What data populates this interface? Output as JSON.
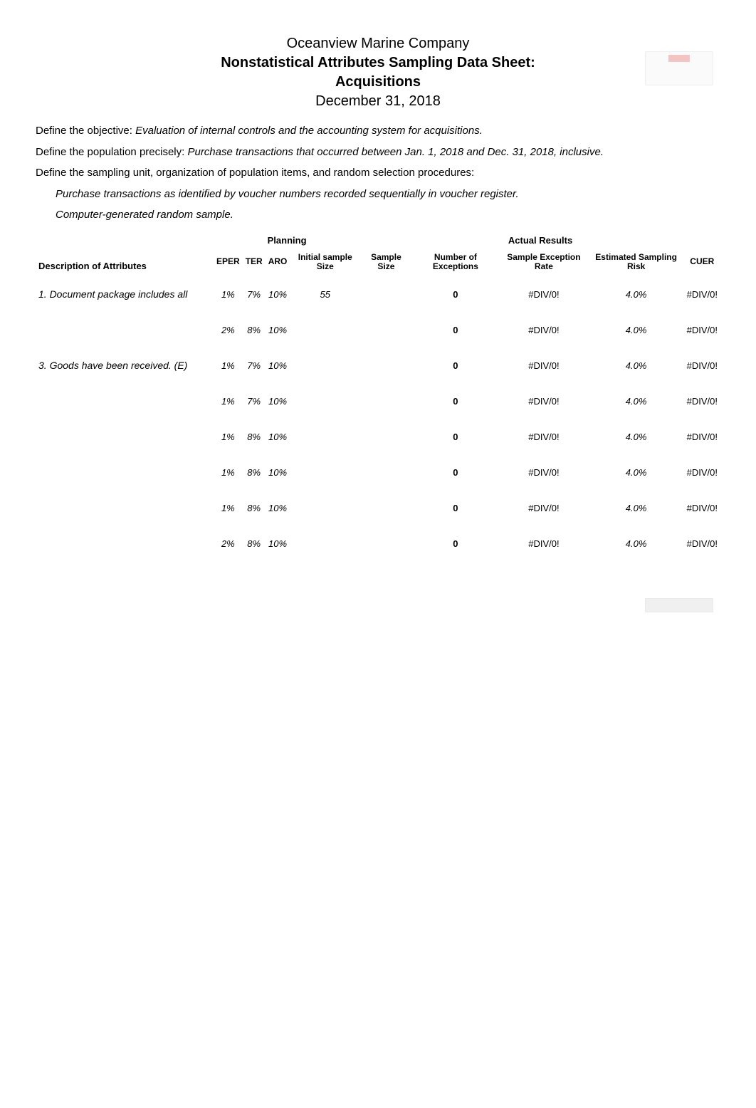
{
  "header": {
    "company": "Oceanview Marine Company",
    "title": "Nonstatistical Attributes Sampling Data Sheet:",
    "subtitle": "Acquisitions",
    "date": "December 31, 2018"
  },
  "defs": {
    "objective_label": "Define the objective:",
    "objective_value": "Evaluation of internal controls and the accounting system for acquisitions.",
    "population_label": "Define the population precisely:",
    "population_value": "Purchase transactions that occurred between Jan. 1, 2018 and Dec. 31, 2018, inclusive.",
    "sampling_label": "Define the sampling unit, organization of population items, and random selection procedures:",
    "sampling_line1": "Purchase transactions as identified by voucher numbers recorded sequentially in voucher register.",
    "sampling_line2": "Computer-generated random sample."
  },
  "table": {
    "group_planning": "Planning",
    "group_results": "Actual Results",
    "headers": {
      "desc": "Description of Attributes",
      "eper": "EPER",
      "ter": "TER",
      "aro": "ARO",
      "initial": "Initial sample Size",
      "sample_size": "Sample Size",
      "num_exc": "Number of Exceptions",
      "ser": "Sample Exception Rate",
      "esr": "Estimated Sampling Risk",
      "cuer": "CUER"
    },
    "rows": [
      {
        "desc": "1. Document package includes all",
        "eper": "1%",
        "ter": "7%",
        "aro": "10%",
        "initial": "55",
        "sample": "",
        "nex": "0",
        "ser": "#DIV/0!",
        "esr": "4.0%",
        "cuer": "#DIV/0!"
      },
      {
        "desc": "",
        "eper": "2%",
        "ter": "8%",
        "aro": "10%",
        "initial": "",
        "sample": "",
        "nex": "0",
        "ser": "#DIV/0!",
        "esr": "4.0%",
        "cuer": "#DIV/0!"
      },
      {
        "desc": "3. Goods have been received. (E)",
        "eper": "1%",
        "ter": "7%",
        "aro": "10%",
        "initial": "",
        "sample": "",
        "nex": "0",
        "ser": "#DIV/0!",
        "esr": "4.0%",
        "cuer": "#DIV/0!"
      },
      {
        "desc": "",
        "eper": "1%",
        "ter": "7%",
        "aro": "10%",
        "initial": "",
        "sample": "",
        "nex": "0",
        "ser": "#DIV/0!",
        "esr": "4.0%",
        "cuer": "#DIV/0!"
      },
      {
        "desc": "",
        "eper": "1%",
        "ter": "8%",
        "aro": "10%",
        "initial": "",
        "sample": "",
        "nex": "0",
        "ser": "#DIV/0!",
        "esr": "4.0%",
        "cuer": "#DIV/0!"
      },
      {
        "desc": "",
        "eper": "1%",
        "ter": "8%",
        "aro": "10%",
        "initial": "",
        "sample": "",
        "nex": "0",
        "ser": "#DIV/0!",
        "esr": "4.0%",
        "cuer": "#DIV/0!"
      },
      {
        "desc": "",
        "eper": "1%",
        "ter": "8%",
        "aro": "10%",
        "initial": "",
        "sample": "",
        "nex": "0",
        "ser": "#DIV/0!",
        "esr": "4.0%",
        "cuer": "#DIV/0!"
      },
      {
        "desc": "",
        "eper": "2%",
        "ter": "8%",
        "aro": "10%",
        "initial": "",
        "sample": "",
        "nex": "0",
        "ser": "#DIV/0!",
        "esr": "4.0%",
        "cuer": "#DIV/0!"
      }
    ]
  }
}
